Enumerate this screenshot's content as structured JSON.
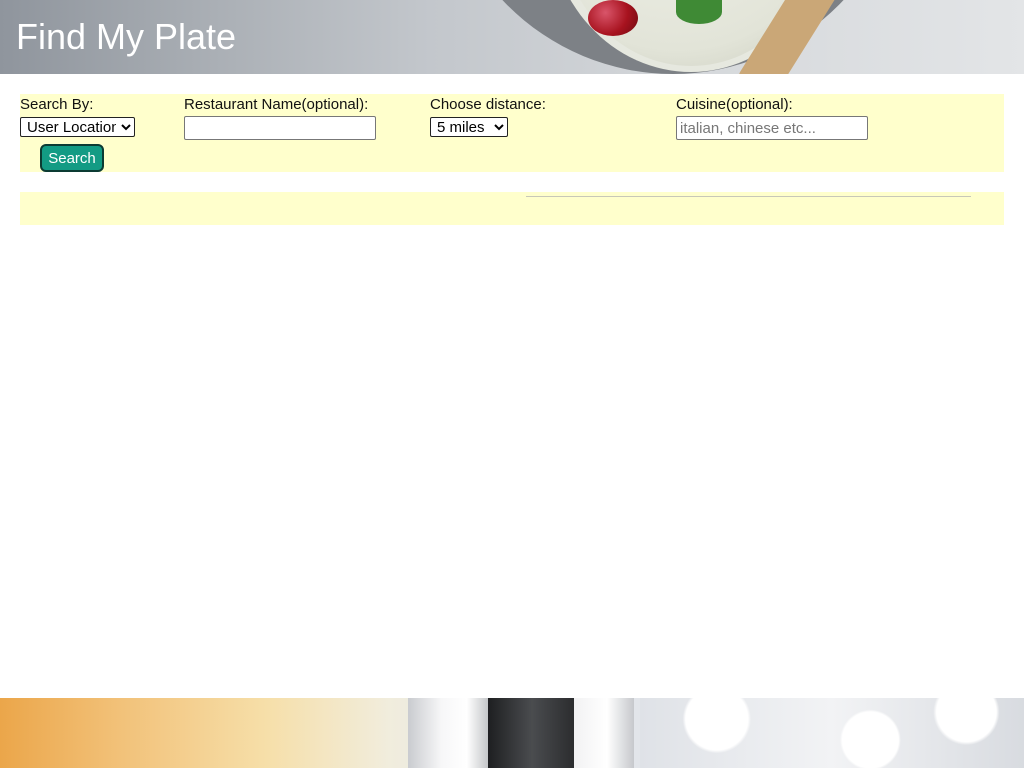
{
  "header": {
    "title": "Find My Plate"
  },
  "search": {
    "search_by": {
      "label": "Search By:",
      "selected": "User Location"
    },
    "restaurant_name": {
      "label": "Restaurant Name(optional):",
      "value": "",
      "placeholder": ""
    },
    "distance": {
      "label": "Choose distance:",
      "selected": "5 miles"
    },
    "cuisine": {
      "label": "Cuisine(optional):",
      "value": "",
      "placeholder": "italian, chinese etc..."
    },
    "button_label": "Search"
  },
  "colors": {
    "panel_background": "#ffffcc",
    "button_background": "#139b84",
    "title_color": "#ffffff"
  }
}
